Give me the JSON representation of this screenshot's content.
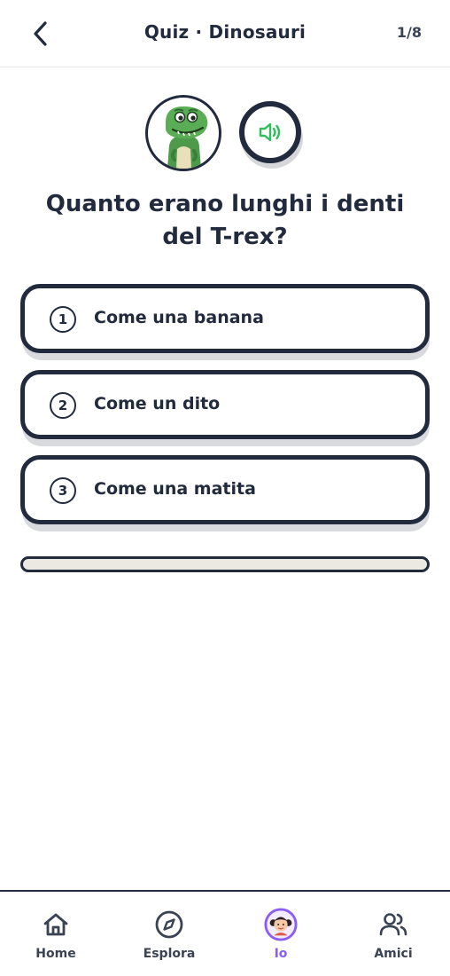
{
  "header": {
    "title": "Quiz · Dinosauri",
    "progress": "1/8"
  },
  "question": {
    "line1": "Quanto erano lunghi i denti",
    "line2": "del T-rex?"
  },
  "options": [
    {
      "number": "1",
      "label": "Come una banana"
    },
    {
      "number": "2",
      "label": "Come un dito"
    },
    {
      "number": "3",
      "label": "Come una matita"
    }
  ],
  "progress_fraction": 0.0,
  "nav": {
    "items": [
      {
        "label": "Home",
        "icon": "home-icon"
      },
      {
        "label": "Esplora",
        "icon": "compass-icon"
      },
      {
        "label": "Io",
        "icon": "avatar-icon"
      },
      {
        "label": "Amici",
        "icon": "friends-icon"
      }
    ]
  },
  "colors": {
    "dark": "#222b3d",
    "accent_green": "#2fbf5a",
    "active_purple": "#8b5cf6"
  }
}
